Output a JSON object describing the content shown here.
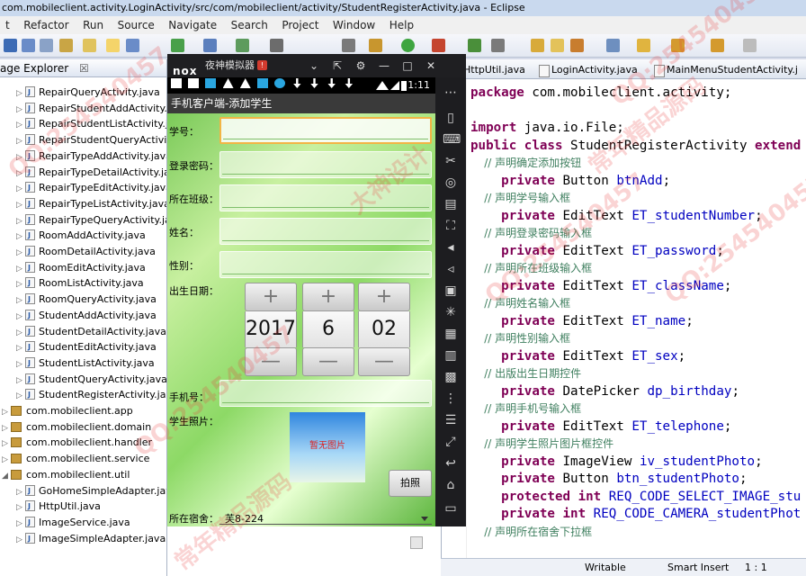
{
  "window": {
    "title": "com.mobileclient.activity.LoginActivity/src/com/mobileclient/activity/StudentRegisterActivity.java - Eclipse"
  },
  "menu": [
    "t",
    "Refactor",
    "Run",
    "Source",
    "Navigate",
    "Search",
    "Project",
    "Window",
    "Help"
  ],
  "package_explorer": {
    "tab_label": "age Explorer",
    "close": "☒",
    "items": [
      {
        "label": "RepairQueryActivity.java",
        "kind": "file"
      },
      {
        "label": "RepairStudentAddActivity.ja",
        "kind": "file"
      },
      {
        "label": "RepairStudentListActivity.ja",
        "kind": "file"
      },
      {
        "label": "RepairStudentQueryActivity",
        "kind": "file"
      },
      {
        "label": "RepairTypeAddActivity.java",
        "kind": "file"
      },
      {
        "label": "RepairTypeDetailActivity.jav",
        "kind": "file"
      },
      {
        "label": "RepairTypeEditActivity.java",
        "kind": "file"
      },
      {
        "label": "RepairTypeListActivity.java",
        "kind": "file"
      },
      {
        "label": "RepairTypeQueryActivity.jav",
        "kind": "file"
      },
      {
        "label": "RoomAddActivity.java",
        "kind": "file"
      },
      {
        "label": "RoomDetailActivity.java",
        "kind": "file"
      },
      {
        "label": "RoomEditActivity.java",
        "kind": "file"
      },
      {
        "label": "RoomListActivity.java",
        "kind": "file"
      },
      {
        "label": "RoomQueryActivity.java",
        "kind": "file"
      },
      {
        "label": "StudentAddActivity.java",
        "kind": "file"
      },
      {
        "label": "StudentDetailActivity.java",
        "kind": "file"
      },
      {
        "label": "StudentEditActivity.java",
        "kind": "file"
      },
      {
        "label": "StudentListActivity.java",
        "kind": "file"
      },
      {
        "label": "StudentQueryActivity.java",
        "kind": "file"
      },
      {
        "label": "StudentRegisterActivity.java",
        "kind": "file"
      },
      {
        "label": "com.mobileclient.app",
        "kind": "package"
      },
      {
        "label": "com.mobileclient.domain",
        "kind": "package"
      },
      {
        "label": "com.mobileclient.handler",
        "kind": "package"
      },
      {
        "label": "com.mobileclient.service",
        "kind": "package"
      },
      {
        "label": "com.mobileclient.util",
        "kind": "package-open"
      },
      {
        "label": "GoHomeSimpleAdapter.jav",
        "kind": "file"
      },
      {
        "label": "HttpUtil.java",
        "kind": "file"
      },
      {
        "label": "ImageService.java",
        "kind": "file"
      },
      {
        "label": "ImageSimpleAdapter.java",
        "kind": "file"
      }
    ]
  },
  "editor": {
    "tabs": [
      "HttpUtil.java",
      "LoginActivity.java",
      "MainMenuStudentActivity.j"
    ],
    "lines": [
      {
        "type": "code",
        "parts": [
          [
            "kw",
            "package"
          ],
          [
            "t",
            " com.mobileclient.activity;"
          ]
        ]
      },
      {
        "type": "blank"
      },
      {
        "type": "code",
        "parts": [
          [
            "kw",
            "import"
          ],
          [
            "t",
            " java.io.File;"
          ]
        ]
      },
      {
        "type": "code",
        "parts": [
          [
            "kw",
            "public class"
          ],
          [
            "t",
            " StudentRegisterActivity "
          ],
          [
            "kw",
            "extend"
          ]
        ]
      },
      {
        "type": "comment",
        "text": "    // 声明确定添加按钮"
      },
      {
        "type": "code",
        "parts": [
          [
            "kw",
            "    private"
          ],
          [
            "t",
            " Button "
          ],
          [
            "fld",
            "btnAdd"
          ],
          [
            "t",
            ";"
          ]
        ]
      },
      {
        "type": "comment",
        "text": "    // 声明学号输入框"
      },
      {
        "type": "code",
        "parts": [
          [
            "kw",
            "    private"
          ],
          [
            "t",
            " EditText "
          ],
          [
            "fld",
            "ET_studentNumber"
          ],
          [
            "t",
            ";"
          ]
        ]
      },
      {
        "type": "comment",
        "text": "    // 声明登录密码输入框"
      },
      {
        "type": "code",
        "parts": [
          [
            "kw",
            "    private"
          ],
          [
            "t",
            " EditText "
          ],
          [
            "fld",
            "ET_password"
          ],
          [
            "t",
            ";"
          ]
        ]
      },
      {
        "type": "comment",
        "text": "    // 声明所在班级输入框"
      },
      {
        "type": "code",
        "parts": [
          [
            "kw",
            "    private"
          ],
          [
            "t",
            " EditText "
          ],
          [
            "fld",
            "ET_className"
          ],
          [
            "t",
            ";"
          ]
        ]
      },
      {
        "type": "comment",
        "text": "    // 声明姓名输入框"
      },
      {
        "type": "code",
        "parts": [
          [
            "kw",
            "    private"
          ],
          [
            "t",
            " EditText "
          ],
          [
            "fld",
            "ET_name"
          ],
          [
            "t",
            ";"
          ]
        ]
      },
      {
        "type": "comment",
        "text": "    // 声明性别输入框"
      },
      {
        "type": "code",
        "parts": [
          [
            "kw",
            "    private"
          ],
          [
            "t",
            " EditText "
          ],
          [
            "fld",
            "ET_sex"
          ],
          [
            "t",
            ";"
          ]
        ]
      },
      {
        "type": "comment",
        "text": "    // 出版出生日期控件"
      },
      {
        "type": "code",
        "parts": [
          [
            "kw",
            "    private"
          ],
          [
            "t",
            " DatePicker "
          ],
          [
            "fld",
            "dp_birthday"
          ],
          [
            "t",
            ";"
          ]
        ]
      },
      {
        "type": "comment",
        "text": "    // 声明手机号输入框"
      },
      {
        "type": "code",
        "parts": [
          [
            "kw",
            "    private"
          ],
          [
            "t",
            " EditText "
          ],
          [
            "fld",
            "ET_telephone"
          ],
          [
            "t",
            ";"
          ]
        ]
      },
      {
        "type": "comment",
        "text": "    // 声明学生照片图片框控件"
      },
      {
        "type": "code",
        "parts": [
          [
            "kw",
            "    private"
          ],
          [
            "t",
            " ImageView "
          ],
          [
            "fld",
            "iv_studentPhoto"
          ],
          [
            "t",
            ";"
          ]
        ]
      },
      {
        "type": "code",
        "parts": [
          [
            "kw",
            "    private"
          ],
          [
            "t",
            " Button "
          ],
          [
            "fld",
            "btn_studentPhoto"
          ],
          [
            "t",
            ";"
          ]
        ]
      },
      {
        "type": "code",
        "parts": [
          [
            "kw",
            "    protected int"
          ],
          [
            "t",
            " "
          ],
          [
            "fld",
            "REQ_CODE_SELECT_IMAGE_stu"
          ]
        ]
      },
      {
        "type": "code",
        "parts": [
          [
            "kw",
            "    private int"
          ],
          [
            "t",
            " "
          ],
          [
            "fld",
            "REQ_CODE_CAMERA_studentPhot"
          ]
        ]
      },
      {
        "type": "comment",
        "text": "    // 声明所在宿舍下拉框"
      }
    ]
  },
  "status": {
    "writable": "Writable",
    "insert_mode": "Smart Insert",
    "position": "1 : 1"
  },
  "emulator": {
    "logo": "nox",
    "name": "夜神模拟器",
    "badge": "!",
    "controls": [
      "⌄",
      "⇱",
      "⚙",
      "—",
      "□",
      "✕"
    ],
    "status_time": "1:11",
    "app_title": "手机客户端-添加学生",
    "form": {
      "student_number_label": "学号：",
      "password_label": "登录密码：",
      "class_label": "所在班级：",
      "name_label": "姓名：",
      "sex_label": "性别：",
      "birthday_label": "出生日期：",
      "telephone_label": "手机号：",
      "photo_label": "学生照片：",
      "photo_placeholder": "暂无图片",
      "photo_button": "拍照",
      "dorm_label": "所在宿舍：",
      "dorm_value": "芙8-224"
    },
    "date_picker": {
      "year": "2017",
      "month": "6",
      "day": "02",
      "plus": "+",
      "minus": "—"
    }
  },
  "watermark": {
    "qq": "QQ:254540457",
    "brand": "常年精品源码",
    "design": "大神设计"
  }
}
